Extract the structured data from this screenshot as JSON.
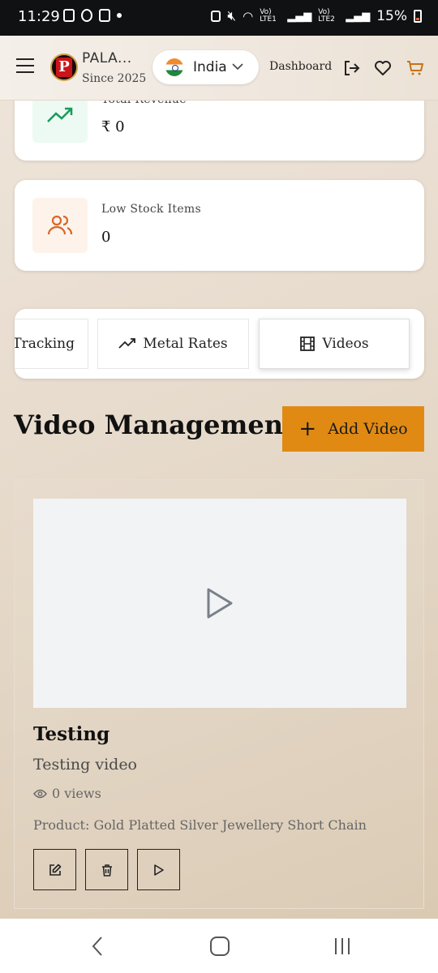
{
  "status_bar": {
    "time": "11:29",
    "network_1": "Vo) LTE1",
    "network_2": "Vo) LTE2",
    "battery": "15%"
  },
  "header": {
    "brand_name": "PALA...",
    "brand_since": "Since 2025",
    "logo_letter": "P",
    "country": "India",
    "dashboard_label": "Dashboard"
  },
  "stats": [
    {
      "label": "Total Revenue",
      "value": "₹ 0",
      "icon": "trending-up-icon",
      "color": "#1a9a5c",
      "bg": "#ecfaf3"
    },
    {
      "label": "Low Stock Items",
      "value": "0",
      "icon": "users-icon",
      "color": "#d9662a",
      "bg": "#fdf3ea"
    }
  ],
  "tabs": [
    {
      "label": "Tracking",
      "icon": ""
    },
    {
      "label": "Metal Rates",
      "icon": "trending-up-icon"
    },
    {
      "label": "Videos",
      "icon": "film-icon",
      "active": true
    }
  ],
  "section": {
    "title": "Video Management",
    "add_button": "Add Video",
    "accent": "#e08a14"
  },
  "video": {
    "title": "Testing",
    "description": "Testing video",
    "views": "0 views",
    "product": "Product: Gold Platted Silver Jewellery Short Chain"
  }
}
